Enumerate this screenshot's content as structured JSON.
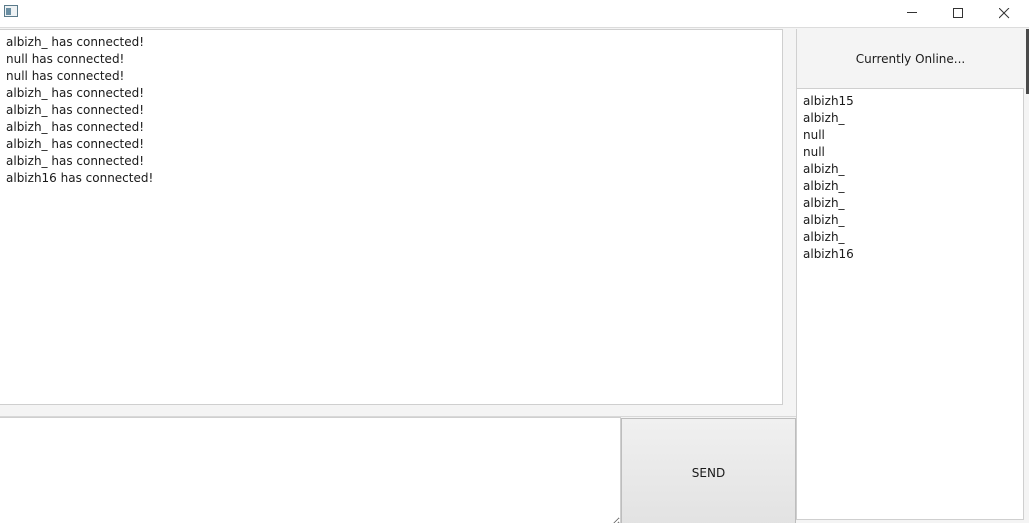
{
  "window": {
    "title_icon": "app-window-icon"
  },
  "chat": {
    "messages": [
      "albizh_ has connected!",
      "null has connected!",
      "null has connected!",
      "albizh_ has connected!",
      "albizh_ has connected!",
      "albizh_ has connected!",
      "albizh_ has connected!",
      "albizh_ has connected!",
      "albizh16 has connected!"
    ]
  },
  "composer": {
    "message_value": "",
    "send_label": "SEND"
  },
  "online": {
    "header": "Currently Online...",
    "users": [
      "albizh15",
      "albizh_",
      "null",
      "null",
      "albizh_",
      "albizh_",
      "albizh_",
      "albizh_",
      "albizh_",
      "albizh16"
    ]
  }
}
